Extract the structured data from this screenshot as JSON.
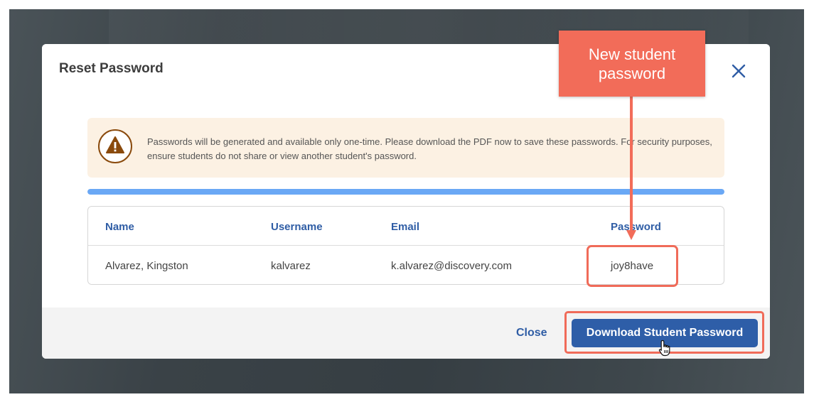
{
  "modal": {
    "title": "Reset Password",
    "close_icon": "close-icon"
  },
  "warning": {
    "icon": "warning-icon",
    "text": "Passwords will be generated and available only one-time. Please download the PDF now to save these passwords. For security purposes, ensure students do not share or view another student's password."
  },
  "progress": {
    "value": 1.0
  },
  "table": {
    "columns": [
      "Name",
      "Username",
      "Email",
      "Password"
    ],
    "rows": [
      [
        "Alvarez, Kingston",
        "kalvarez",
        "k.alvarez@discovery.com",
        "joy8have"
      ]
    ]
  },
  "footer": {
    "close_label": "Close",
    "download_label": "Download Student Password"
  },
  "annotation": {
    "callout_line1": "New student",
    "callout_line2": "password"
  },
  "colors": {
    "primary": "#2e5ea8",
    "header_text": "#2f5da5",
    "callout": "#f26c59",
    "warning_bg": "#fcf1e3",
    "warning_icon": "#8a4a0c",
    "progress": "#6aa8f5"
  }
}
